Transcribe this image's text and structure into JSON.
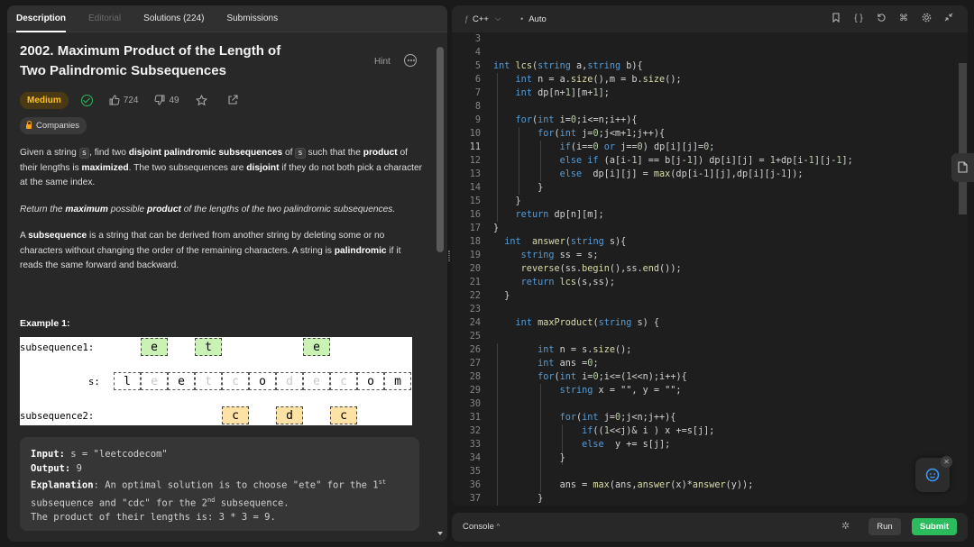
{
  "tabs": {
    "description": "Description",
    "editorial": "Editorial",
    "solutions": "Solutions (224)",
    "submissions": "Submissions"
  },
  "problem": {
    "title": "2002. Maximum Product of the Length of Two Palindromic Subsequences",
    "hint": "Hint",
    "difficulty": "Medium",
    "likes": "724",
    "dislikes": "49",
    "companies": "Companies",
    "example_title": "Example 1:"
  },
  "figure": {
    "label_sub1": "subsequence1:",
    "label_s": "s:",
    "label_sub2": "subsequence2:",
    "s_chars": [
      "l",
      "e",
      "e",
      "t",
      "c",
      "o",
      "d",
      "e",
      "c",
      "o",
      "m"
    ],
    "sub1_chars": [
      "e",
      "t",
      "e"
    ],
    "sub2_chars": [
      "c",
      "d",
      "c"
    ]
  },
  "explanation": {
    "input_label": "Input:",
    "input_value": "s = \"leetcodecom\"",
    "output_label": "Output:",
    "output_value": "9",
    "expl_label": "Explanation",
    "expl_a": ": An optimal solution is to choose \"ete\" for the 1",
    "expl_sup1": "st",
    "expl_b": "subsequence and \"cdc\" for the 2",
    "expl_sup2": "nd",
    "expl_c": " subsequence.",
    "expl_d": "The product of their lengths is: 3 * 3 = 9."
  },
  "editor": {
    "language": "C++",
    "mode": "Auto",
    "icons": [
      "bookmark-icon",
      "braces-icon",
      "reset-icon",
      "command-icon",
      "settings-icon",
      "collapse-icon"
    ],
    "line_numbers": [
      "3",
      "4",
      "5",
      "6",
      "7",
      "8",
      "9",
      "10",
      "11",
      "12",
      "13",
      "14",
      "15",
      "16",
      "17",
      "18",
      "19",
      "20",
      "21",
      "22",
      "23",
      "24",
      "25",
      "26",
      "27",
      "28",
      "29",
      "30",
      "31",
      "32",
      "33",
      "34",
      "35",
      "36",
      "37"
    ],
    "current_line": "11"
  },
  "console": {
    "label": "Console",
    "run": "Run",
    "submit": "Submit"
  }
}
